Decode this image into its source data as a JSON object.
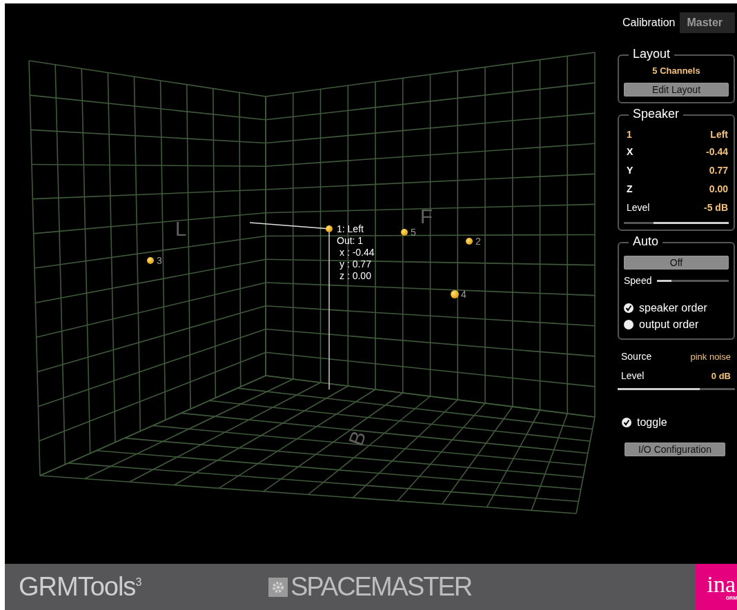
{
  "scene": {
    "axis_labels": [
      {
        "kind": "left",
        "text": "L"
      },
      {
        "kind": "front",
        "text": "F"
      },
      {
        "kind": "back",
        "text": "B"
      }
    ],
    "speakers": [
      {
        "selected": true
      },
      {
        "label": "5",
        "selected": false
      },
      {
        "label": "2",
        "selected": false
      },
      {
        "label": "3",
        "selected": false
      },
      {
        "label": "4",
        "selected": false
      }
    ],
    "info": {
      "title": "1: Left",
      "lines": [
        "Out: 1",
        "x : -0.44",
        "y : 0.77",
        "z : 0.00"
      ]
    }
  },
  "tabs": [
    {
      "label": "Calibration",
      "selected": true
    },
    {
      "label": "Master",
      "selected": false
    }
  ],
  "layout": {
    "title": "Layout",
    "channels": "5 Channels",
    "button": "Edit Layout"
  },
  "speaker": {
    "title": "Speaker",
    "rows": [
      {
        "label": "1",
        "value": "Left",
        "kind": "accent"
      },
      {
        "label": "X",
        "value": "-0.44",
        "kind": "plain"
      },
      {
        "label": "Y",
        "value": "0.77",
        "kind": "plain"
      },
      {
        "label": "Z",
        "value": "0.00",
        "kind": "plain"
      },
      {
        "label": "Level",
        "value": "-5 dB",
        "kind": "normal"
      }
    ],
    "level": 0.28
  },
  "auto": {
    "title": "Auto",
    "button": "Off",
    "speed_label": "Speed",
    "speed": {
      "level": 0.2
    },
    "options": [
      {
        "label": "speaker order",
        "selected": true
      },
      {
        "label": "output order",
        "selected": false
      }
    ]
  },
  "source": {
    "label": "Source",
    "value": "pink noise",
    "level_label": "Level",
    "level_value": "0 dB",
    "level": 0.7
  },
  "toggle": {
    "label": "toggle",
    "checked": true
  },
  "io_button": "I/O Configuration",
  "footer": {
    "brand": "GRMTools$^{3}$",
    "product": "SPACEMASTER",
    "logo": "ina",
    "logo_sub": "GRM"
  }
}
